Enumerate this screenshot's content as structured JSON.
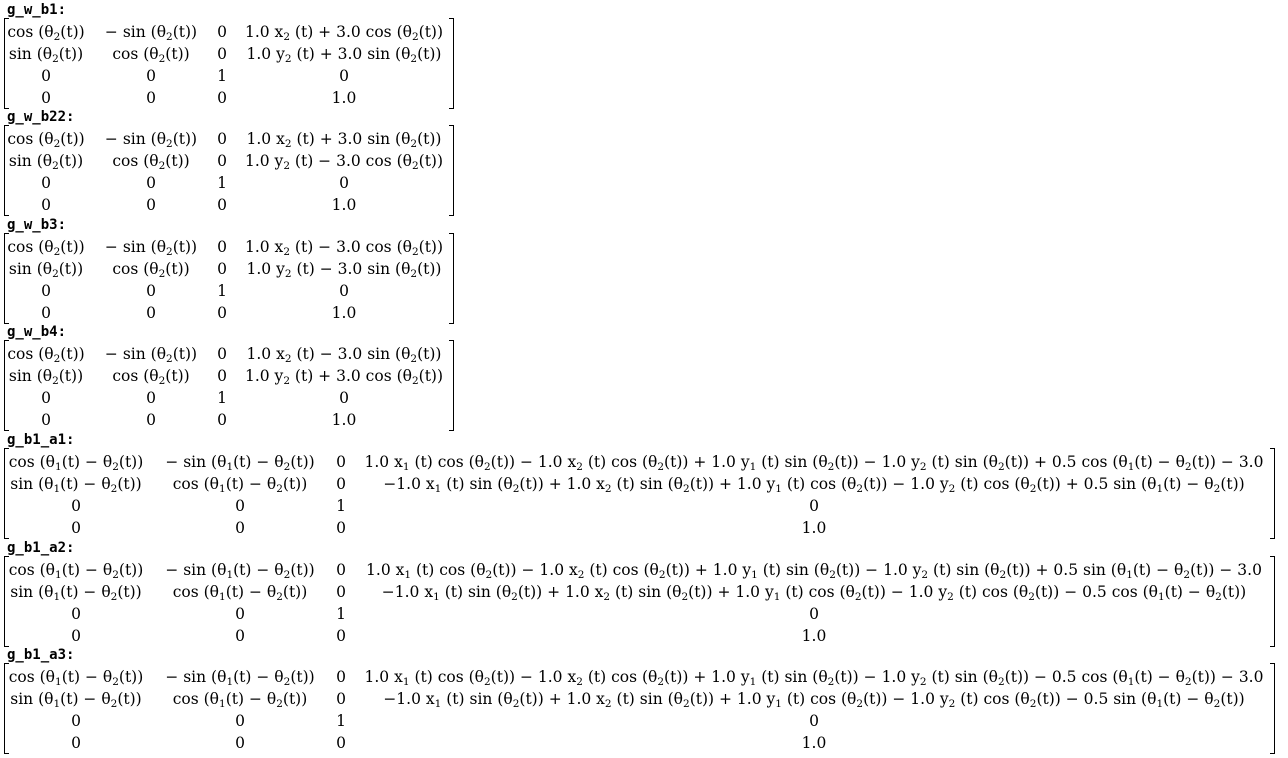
{
  "matrices": [
    {
      "label": "g_w_b1:",
      "rows": [
        [
          "cos (θ_2(t))",
          "− sin (θ_2(t))",
          "0",
          "1.0 x_2 (t) + 3.0 cos (θ_2(t))"
        ],
        [
          "sin (θ_2(t))",
          "cos (θ_2(t))",
          "0",
          "1.0 y_2 (t) + 3.0 sin (θ_2(t))"
        ],
        [
          "0",
          "0",
          "1",
          "0"
        ],
        [
          "0",
          "0",
          "0",
          "1.0"
        ]
      ]
    },
    {
      "label": "g_w_b22:",
      "rows": [
        [
          "cos (θ_2(t))",
          "− sin (θ_2(t))",
          "0",
          "1.0 x_2 (t) + 3.0 sin (θ_2(t))"
        ],
        [
          "sin (θ_2(t))",
          "cos (θ_2(t))",
          "0",
          "1.0 y_2 (t) − 3.0 cos (θ_2(t))"
        ],
        [
          "0",
          "0",
          "1",
          "0"
        ],
        [
          "0",
          "0",
          "0",
          "1.0"
        ]
      ]
    },
    {
      "label": "g_w_b3:",
      "rows": [
        [
          "cos (θ_2(t))",
          "− sin (θ_2(t))",
          "0",
          "1.0 x_2 (t) − 3.0 cos (θ_2(t))"
        ],
        [
          "sin (θ_2(t))",
          "cos (θ_2(t))",
          "0",
          "1.0 y_2 (t) − 3.0 sin (θ_2(t))"
        ],
        [
          "0",
          "0",
          "1",
          "0"
        ],
        [
          "0",
          "0",
          "0",
          "1.0"
        ]
      ]
    },
    {
      "label": "g_w_b4:",
      "rows": [
        [
          "cos (θ_2(t))",
          "− sin (θ_2(t))",
          "0",
          "1.0 x_2 (t) − 3.0 sin (θ_2(t))"
        ],
        [
          "sin (θ_2(t))",
          "cos (θ_2(t))",
          "0",
          "1.0 y_2 (t) + 3.0 cos (θ_2(t))"
        ],
        [
          "0",
          "0",
          "1",
          "0"
        ],
        [
          "0",
          "0",
          "0",
          "1.0"
        ]
      ]
    },
    {
      "label": "g_b1_a1:",
      "rows": [
        [
          "cos (θ_1(t) − θ_2(t))",
          "− sin (θ_1(t) − θ_2(t))",
          "0",
          "1.0 x_1 (t) cos (θ_2(t)) − 1.0 x_2 (t) cos (θ_2(t)) + 1.0 y_1 (t) sin (θ_2(t)) − 1.0 y_2 (t) sin (θ_2(t)) + 0.5 cos (θ_1(t) − θ_2(t)) − 3.0"
        ],
        [
          "sin (θ_1(t) − θ_2(t))",
          "cos (θ_1(t) − θ_2(t))",
          "0",
          "−1.0 x_1 (t) sin (θ_2(t)) + 1.0 x_2 (t) sin (θ_2(t)) + 1.0 y_1 (t) cos (θ_2(t)) − 1.0 y_2 (t) cos (θ_2(t)) + 0.5 sin (θ_1(t) − θ_2(t))"
        ],
        [
          "0",
          "0",
          "1",
          "0"
        ],
        [
          "0",
          "0",
          "0",
          "1.0"
        ]
      ]
    },
    {
      "label": "g_b1_a2:",
      "rows": [
        [
          "cos (θ_1(t) − θ_2(t))",
          "− sin (θ_1(t) − θ_2(t))",
          "0",
          "1.0 x_1 (t) cos (θ_2(t)) − 1.0 x_2 (t) cos (θ_2(t)) + 1.0 y_1 (t) sin (θ_2(t)) − 1.0 y_2 (t) sin (θ_2(t)) + 0.5 sin (θ_1(t) − θ_2(t)) − 3.0"
        ],
        [
          "sin (θ_1(t) − θ_2(t))",
          "cos (θ_1(t) − θ_2(t))",
          "0",
          "−1.0 x_1 (t) sin (θ_2(t)) + 1.0 x_2 (t) sin (θ_2(t)) + 1.0 y_1 (t) cos (θ_2(t)) − 1.0 y_2 (t) cos (θ_2(t)) − 0.5 cos (θ_1(t) − θ_2(t))"
        ],
        [
          "0",
          "0",
          "1",
          "0"
        ],
        [
          "0",
          "0",
          "0",
          "1.0"
        ]
      ]
    },
    {
      "label": "g_b1_a3:",
      "rows": [
        [
          "cos (θ_1(t) − θ_2(t))",
          "− sin (θ_1(t) − θ_2(t))",
          "0",
          "1.0 x_1 (t) cos (θ_2(t)) − 1.0 x_2 (t) cos (θ_2(t)) + 1.0 y_1 (t) sin (θ_2(t)) − 1.0 y_2 (t) sin (θ_2(t)) − 0.5 cos (θ_1(t) − θ_2(t)) − 3.0"
        ],
        [
          "sin (θ_1(t) − θ_2(t))",
          "cos (θ_1(t) − θ_2(t))",
          "0",
          "−1.0 x_1 (t) sin (θ_2(t)) + 1.0 x_2 (t) sin (θ_2(t)) + 1.0 y_1 (t) cos (θ_2(t)) − 1.0 y_2 (t) cos (θ_2(t)) − 0.5 sin (θ_1(t) − θ_2(t))"
        ],
        [
          "0",
          "0",
          "1",
          "0"
        ],
        [
          "0",
          "0",
          "0",
          "1.0"
        ]
      ]
    }
  ]
}
